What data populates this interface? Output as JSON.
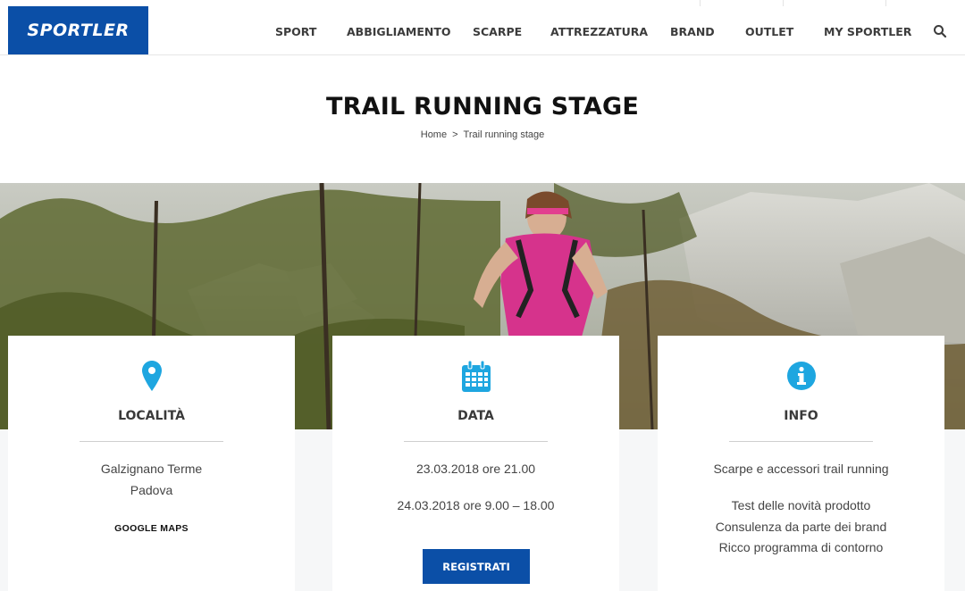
{
  "header": {
    "logo_text": "SPORTLER",
    "brand_color": "#0b4fa7",
    "nav": [
      "SPORT",
      "ABBIGLIAMENTO",
      "SCARPE",
      "ATTREZZATURA",
      "BRAND",
      "OUTLET",
      "MY SPORTLER"
    ],
    "search_icon": "search-icon"
  },
  "page": {
    "title": "TRAIL RUNNING STAGE",
    "breadcrumb": {
      "home": "Home",
      "separator": ">",
      "current": "Trail running stage"
    }
  },
  "cards": [
    {
      "icon": "map-pin-icon",
      "title": "LOCALITÀ",
      "lines": [
        "Galzignano Terme",
        "Padova"
      ],
      "link": "GOOGLE MAPS"
    },
    {
      "icon": "calendar-icon",
      "title": "DATA",
      "lines": [
        "23.03.2018 ore 21.00",
        "24.03.2018 ore 9.00 – 18.00"
      ],
      "button": "REGISTRATI"
    },
    {
      "icon": "info-icon",
      "title": "INFO",
      "lines": [
        "Scarpe e accessori trail running",
        "Test delle novità prodotto",
        "Consulenza da parte dei brand",
        "Ricco programma di contorno"
      ]
    }
  ],
  "colors": {
    "icon": "#1ea6e0",
    "button": "#0b4fa7"
  }
}
